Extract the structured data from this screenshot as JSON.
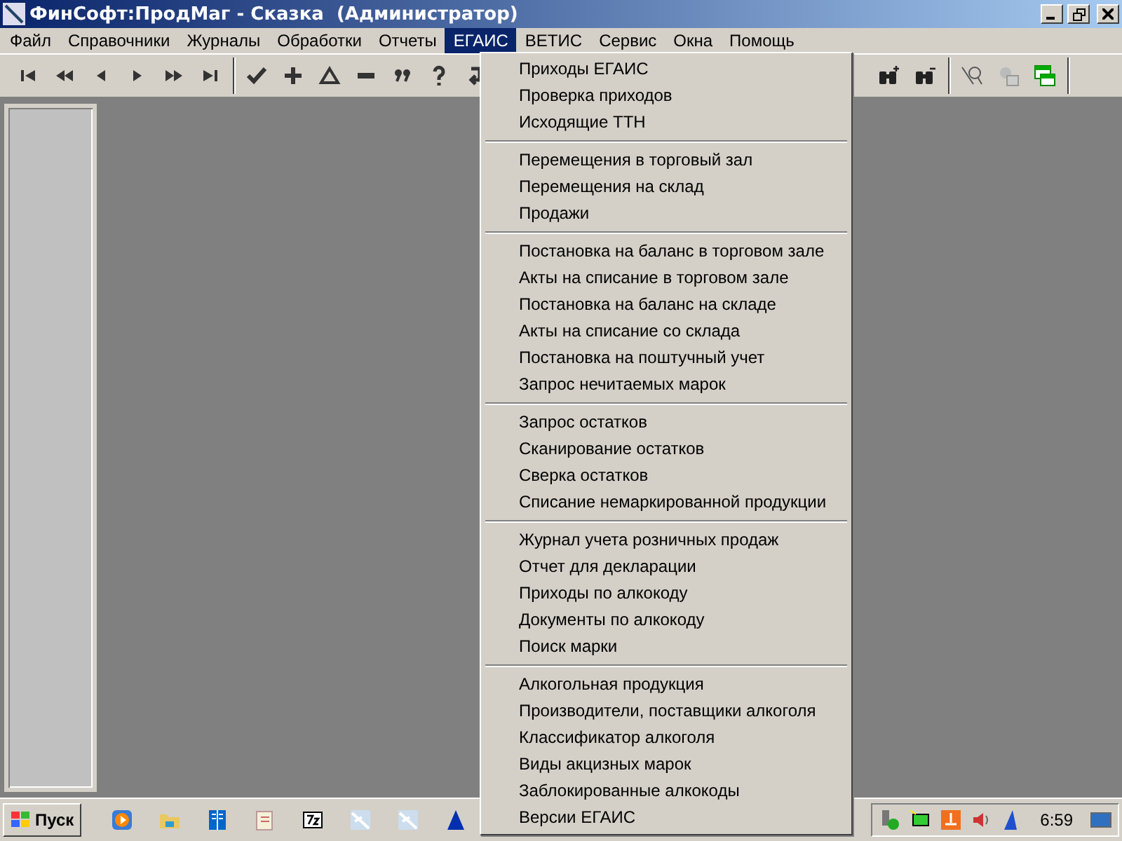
{
  "window": {
    "title": "ФинСофт:ПродМаг - Сказка  (Администратор)"
  },
  "menu_bar": [
    {
      "label": "Файл",
      "selected": false
    },
    {
      "label": "Справочники",
      "selected": false
    },
    {
      "label": "Журналы",
      "selected": false
    },
    {
      "label": "Обработки",
      "selected": false
    },
    {
      "label": "Отчеты",
      "selected": false
    },
    {
      "label": "ЕГАИС",
      "selected": true
    },
    {
      "label": "ВЕТИС",
      "selected": false
    },
    {
      "label": "Сервис",
      "selected": false
    },
    {
      "label": "Окна",
      "selected": false
    },
    {
      "label": "Помощь",
      "selected": false
    }
  ],
  "dropdown_menu": {
    "sections": [
      {
        "items": [
          "Приходы ЕГАИС",
          "Проверка приходов",
          "Исходящие ТТН"
        ]
      },
      {
        "items": [
          "Перемещения в торговый зал",
          "Перемещения на склад",
          "Продажи"
        ]
      },
      {
        "items": [
          "Постановка на баланс в торговом зале",
          "Акты на списание в торговом зале",
          "Постановка на баланс на складе",
          "Акты на списание со склада",
          "Постановка на поштучный учет",
          "Запрос нечитаемых марок"
        ]
      },
      {
        "items": [
          "Запрос остатков",
          "Сканирование остатков",
          "Сверка остатков",
          "Списание немаркированной продукции"
        ]
      },
      {
        "items": [
          "Журнал учета розничных продаж",
          "Отчет для декларации",
          "Приходы по алкокоду",
          "Документы по алкокоду",
          "Поиск марки"
        ]
      },
      {
        "items": [
          "Алкогольная продукция",
          "Производители, поставщики алкоголя",
          "Классификатор алкоголя",
          "Виды акцизных марок",
          "Заблокированные алкокоды",
          "Версии ЕГАИС"
        ]
      }
    ]
  },
  "taskbar": {
    "start_label": "Пуск",
    "clock": "6:59"
  }
}
